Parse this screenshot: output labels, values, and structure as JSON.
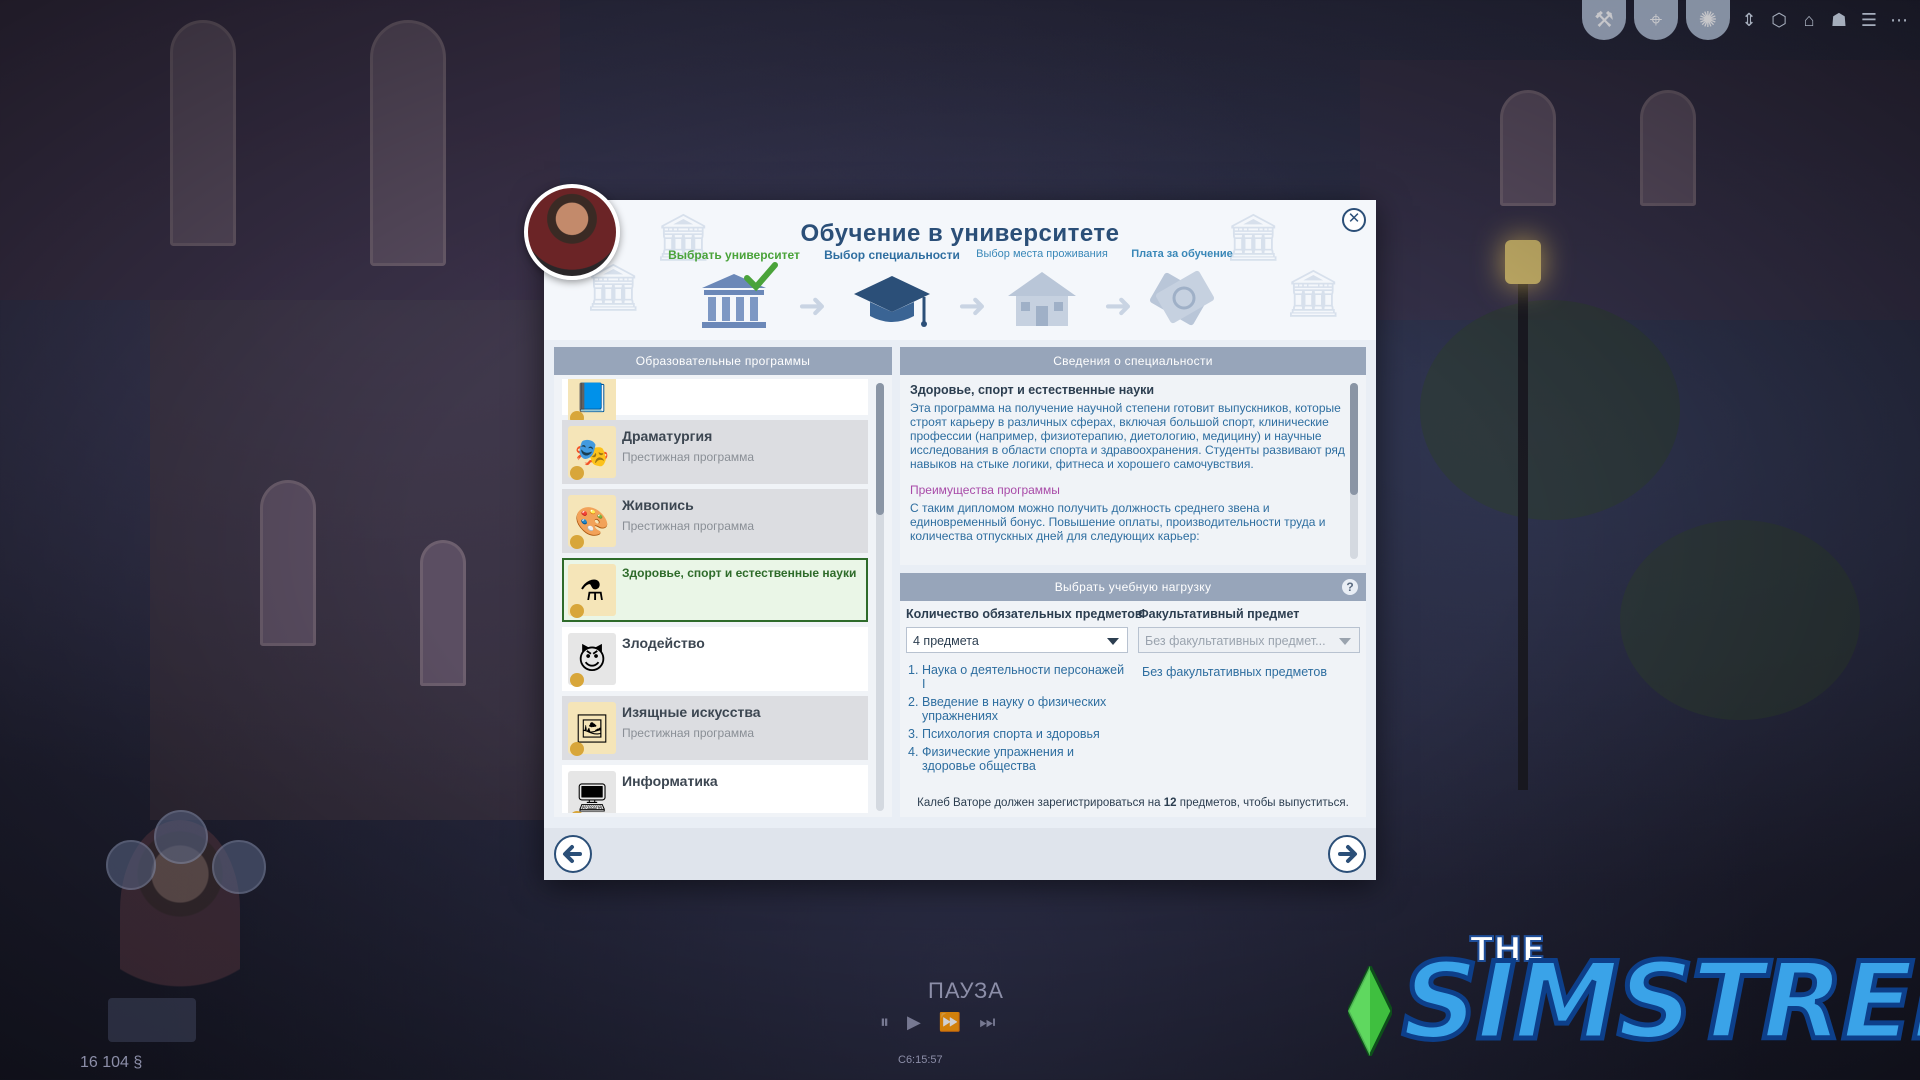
{
  "dialog": {
    "title": "Обучение в университете",
    "close_label": "✕",
    "steps": [
      {
        "label": "Выбрать университет",
        "state": "done"
      },
      {
        "label": "Выбор специальности",
        "state": "active"
      },
      {
        "label": "Выбор места проживания",
        "state": "todo"
      },
      {
        "label": "Плата за обучение",
        "state": "todo"
      }
    ]
  },
  "programs": {
    "header": "Образовательные программы",
    "items": [
      {
        "name": "",
        "sub": "",
        "icon": "book-icon"
      },
      {
        "name": "Драматургия",
        "sub": "Престижная программа",
        "icon": "theatre-masks-icon"
      },
      {
        "name": "Живопись",
        "sub": "Престижная программа",
        "icon": "palette-icon"
      },
      {
        "name": "Здоровье, спорт и естественные науки",
        "sub": "",
        "icon": "flask-icon",
        "selected": true
      },
      {
        "name": "Злодейство",
        "sub": "",
        "icon": "devil-icon"
      },
      {
        "name": "Изящные искусства",
        "sub": "Престижная программа",
        "icon": "painting-icon"
      },
      {
        "name": "Информатика",
        "sub": "",
        "icon": "monitor-icon"
      }
    ]
  },
  "details": {
    "header": "Сведения о специальности",
    "title": "Здоровье, спорт и естественные науки",
    "description": "Эта программа на получение научной степени готовит выпускников, которые строят карьеру в различных сферах, включая большой спорт, клинические профессии (например, физиотерапию, диетологию, медицину) и научные исследования в области спорта и здравоохранения. Студенты развивают ряд навыков на стыке логики, фитнеса и хорошего самочувствия.",
    "advantages_title": "Преимущества программы",
    "advantages": "С таким дипломом можно получить должность среднего звена и единовременный бонус. Повышение оплаты, производительности труда и количества отпускных дней для следующих карьер:"
  },
  "load": {
    "header": "Выбрать учебную нагрузку",
    "help": "?",
    "required_label": "Количество обязательных предметов",
    "required_value": "4 предмета",
    "elective_label": "Факультативный предмет",
    "elective_placeholder": "Без факультативных предмет...",
    "elective_value": "Без факультативных предметов",
    "courses": [
      {
        "n": "1.",
        "name": "Наука о деятельности персонажей I"
      },
      {
        "n": "2.",
        "name": "Введение в науку о физических упражнениях"
      },
      {
        "n": "3.",
        "name": "Психология спорта и здоровья"
      },
      {
        "n": "4.",
        "name": "Физические упражнения и здоровье общества"
      }
    ],
    "note_pre": "Калеб Ваторе должен зарегистрироваться на ",
    "note_num": "12",
    "note_post": " предметов, чтобы выпуститься."
  },
  "hud": {
    "pause": "ПАУЗА",
    "time": "С6:15:57",
    "funds": "16 104 §"
  },
  "watermark": {
    "the": "THE",
    "word": "SIMSTREE"
  },
  "colors": {
    "accent": "#2b4f78",
    "done": "#4aa33a",
    "selected": "#2e6b2a",
    "advantages": "#a84aa8"
  }
}
